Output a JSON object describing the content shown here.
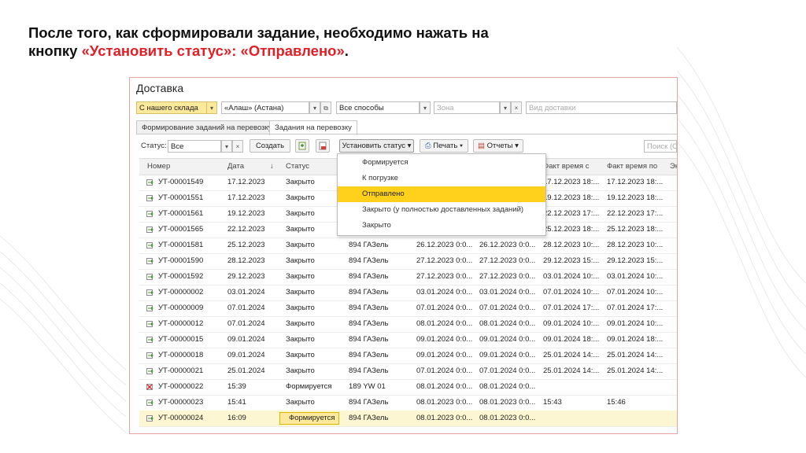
{
  "heading": {
    "line1": "После того, как сформировали задание, необходимо нажать на",
    "line2_prefix": "кнопку ",
    "line2_accent": "«Установить статус»: «Отправлено»",
    "line2_suffix": "."
  },
  "window": {
    "title": "Доставка"
  },
  "filters": {
    "warehouse": "С нашего склада",
    "client": "«Алаш» (Астана)",
    "method": "Все способы",
    "zone_placeholder": "Зона",
    "delivery_type_placeholder": "Вид доставки"
  },
  "tabs": [
    {
      "label": "Формирование заданий на перевозку",
      "active": false
    },
    {
      "label": "Задания на перевозку",
      "active": true
    }
  ],
  "toolbar": {
    "status_label": "Статус:",
    "status_value": "Все",
    "create": "Создать",
    "set_status": "Установить статус",
    "print": "Печать",
    "reports": "Отчеты",
    "search_placeholder": "Поиск (Ct"
  },
  "table": {
    "columns": [
      "Номер",
      "Дата",
      "Статус",
      "",
      "",
      "",
      "Факт время с",
      "Факт время по",
      "Эк"
    ],
    "rows": [
      [
        "УТ-00001549",
        "17.12.2023",
        "Закрыто",
        "",
        "",
        "",
        "17.12.2023 18:...",
        "17.12.2023 18:..."
      ],
      [
        "УТ-00001551",
        "17.12.2023",
        "Закрыто",
        "",
        "",
        "",
        "19.12.2023 18:...",
        "19.12.2023 18:..."
      ],
      [
        "УТ-00001561",
        "19.12.2023",
        "Закрыто",
        "",
        "",
        "",
        "22.12.2023 17:...",
        "22.12.2023 17:..."
      ],
      [
        "УТ-00001565",
        "22.12.2023",
        "Закрыто",
        "",
        "",
        "",
        "25.12.2023 18:...",
        "25.12.2023 18:..."
      ],
      [
        "УТ-00001581",
        "25.12.2023",
        "Закрыто",
        "894 ГАЗель",
        "26.12.2023 0:0...",
        "26.12.2023 0:0...",
        "28.12.2023 10:...",
        "28.12.2023 10:..."
      ],
      [
        "УТ-00001590",
        "28.12.2023",
        "Закрыто",
        "894 ГАЗель",
        "27.12.2023 0:0...",
        "27.12.2023 0:0...",
        "29.12.2023 15:...",
        "29.12.2023 15:..."
      ],
      [
        "УТ-00001592",
        "29.12.2023",
        "Закрыто",
        "894 ГАЗель",
        "27.12.2023 0:0...",
        "27.12.2023 0:0...",
        "03.01.2024 10:...",
        "03.01.2024 10:..."
      ],
      [
        "УТ-00000002",
        "03.01.2024",
        "Закрыто",
        "894 ГАЗель",
        "03.01.2024 0:0...",
        "03.01.2024 0:0...",
        "07.01.2024 10:...",
        "07.01.2024 10:..."
      ],
      [
        "УТ-00000009",
        "07.01.2024",
        "Закрыто",
        "894 ГАЗель",
        "07.01.2024 0:0...",
        "07.01.2024 0:0...",
        "07.01.2024 17:...",
        "07.01.2024 17:..."
      ],
      [
        "УТ-00000012",
        "07.01.2024",
        "Закрыто",
        "894 ГАЗель",
        "08.01.2024 0:0...",
        "08.01.2024 0:0...",
        "09.01.2024 10:...",
        "09.01.2024 10:..."
      ],
      [
        "УТ-00000015",
        "09.01.2024",
        "Закрыто",
        "894 ГАЗель",
        "09.01.2024 0:0...",
        "09.01.2024 0:0...",
        "09.01.2024 18:...",
        "09.01.2024 18:..."
      ],
      [
        "УТ-00000018",
        "09.01.2024",
        "Закрыто",
        "894 ГАЗель",
        "09.01.2024 0:0...",
        "09.01.2024 0:0...",
        "25.01.2024 14:...",
        "25.01.2024 14:..."
      ],
      [
        "УТ-00000021",
        "25.01.2024",
        "Закрыто",
        "894 ГАЗель",
        "07.01.2024 0:0...",
        "07.01.2024 0:0...",
        "25.01.2024 14:...",
        "25.01.2024 14:..."
      ],
      [
        "УТ-00000022",
        "15:39",
        "Формируется",
        "189 YW 01",
        "08.01.2024 0:0...",
        "08.01.2024 0:0...",
        "",
        ""
      ],
      [
        "УТ-00000023",
        "15:41",
        "Закрыто",
        "894 ГАЗель",
        "08.01.2023 0:0...",
        "08.01.2023 0:0...",
        "15:43",
        "15:46"
      ],
      [
        "УТ-00000024",
        "16:09",
        "Формируется",
        "894 ГАЗель",
        "08.01.2023 0:0...",
        "08.01.2023 0:0...",
        "",
        ""
      ]
    ]
  },
  "status_menu": {
    "items": [
      "Формируется",
      "К погрузке",
      "Отправлено",
      "Закрыто (у полностью доставленных заданий)",
      "Закрыто"
    ],
    "highlighted": "Отправлено"
  },
  "colors": {
    "accent": "#e21f26",
    "highlight": "#ffd11c",
    "selected_row": "#fdf6d2"
  },
  "icons": {
    "doc": "document-icon",
    "doc_error": "document-error-icon"
  }
}
